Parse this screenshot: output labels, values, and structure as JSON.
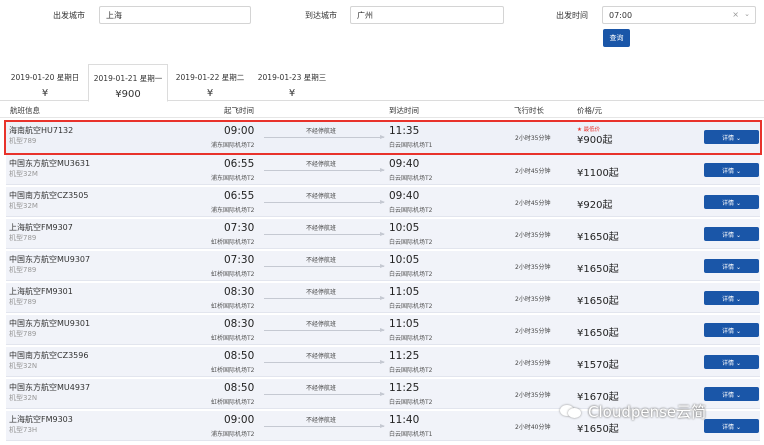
{
  "search": {
    "from_label": "出发城市",
    "from_value": "上海",
    "to_label": "到达城市",
    "to_value": "广州",
    "time_label": "出发时间",
    "time_value": "07:00",
    "clear_glyph": "×",
    "caret_glyph": "⌄",
    "query_label": "查询"
  },
  "date_tabs": [
    {
      "date": "2019-01-20 星期日",
      "price": "¥",
      "active": false
    },
    {
      "date": "2019-01-21 星期一",
      "price": "¥900",
      "active": true
    },
    {
      "date": "2019-01-22 星期二",
      "price": "¥",
      "active": false
    },
    {
      "date": "2019-01-23 星期三",
      "price": "¥",
      "active": false
    }
  ],
  "table_header": {
    "flight_info": "航班信息",
    "depart_time": "起飞时间",
    "arrive_time": "到达时间",
    "duration": "飞行时长",
    "price": "价格/元"
  },
  "rows": [
    {
      "airline": "海南航空HU7132",
      "plane": "机型789",
      "dep": "09:00",
      "dep_airport": "浦东国际机场T2",
      "nonstop": "不经停航班",
      "arr": "11:35",
      "arr_airport": "白云国际机场T1",
      "duration": "2小时35分钟",
      "price": "¥900起",
      "badge": "★ 最低价",
      "detail": "详情 ⌄"
    },
    {
      "airline": "中国东方航空MU3631",
      "plane": "机型32M",
      "dep": "06:55",
      "dep_airport": "浦东国际机场T2",
      "nonstop": "不经停航班",
      "arr": "09:40",
      "arr_airport": "白云国际机场T2",
      "duration": "2小时45分钟",
      "price": "¥1100起",
      "badge": "",
      "detail": "详情 ⌄"
    },
    {
      "airline": "中国南方航空CZ3505",
      "plane": "机型32M",
      "dep": "06:55",
      "dep_airport": "浦东国际机场T2",
      "nonstop": "不经停航班",
      "arr": "09:40",
      "arr_airport": "白云国际机场T2",
      "duration": "2小时45分钟",
      "price": "¥920起",
      "badge": "",
      "detail": "详情 ⌄"
    },
    {
      "airline": "上海航空FM9307",
      "plane": "机型789",
      "dep": "07:30",
      "dep_airport": "虹桥国际机场T2",
      "nonstop": "不经停航班",
      "arr": "10:05",
      "arr_airport": "白云国际机场T2",
      "duration": "2小时35分钟",
      "price": "¥1650起",
      "badge": "",
      "detail": "详情 ⌄"
    },
    {
      "airline": "中国东方航空MU9307",
      "plane": "机型789",
      "dep": "07:30",
      "dep_airport": "虹桥国际机场T2",
      "nonstop": "不经停航班",
      "arr": "10:05",
      "arr_airport": "白云国际机场T2",
      "duration": "2小时35分钟",
      "price": "¥1650起",
      "badge": "",
      "detail": "详情 ⌄"
    },
    {
      "airline": "上海航空FM9301",
      "plane": "机型789",
      "dep": "08:30",
      "dep_airport": "虹桥国际机场T2",
      "nonstop": "不经停航班",
      "arr": "11:05",
      "arr_airport": "白云国际机场T2",
      "duration": "2小时35分钟",
      "price": "¥1650起",
      "badge": "",
      "detail": "详情 ⌄"
    },
    {
      "airline": "中国东方航空MU9301",
      "plane": "机型789",
      "dep": "08:30",
      "dep_airport": "虹桥国际机场T2",
      "nonstop": "不经停航班",
      "arr": "11:05",
      "arr_airport": "白云国际机场T2",
      "duration": "2小时35分钟",
      "price": "¥1650起",
      "badge": "",
      "detail": "详情 ⌄"
    },
    {
      "airline": "中国南方航空CZ3596",
      "plane": "机型32N",
      "dep": "08:50",
      "dep_airport": "虹桥国际机场T2",
      "nonstop": "不经停航班",
      "arr": "11:25",
      "arr_airport": "白云国际机场T2",
      "duration": "2小时35分钟",
      "price": "¥1570起",
      "badge": "",
      "detail": "详情 ⌄"
    },
    {
      "airline": "中国东方航空MU4937",
      "plane": "机型32N",
      "dep": "08:50",
      "dep_airport": "虹桥国际机场T2",
      "nonstop": "不经停航班",
      "arr": "11:25",
      "arr_airport": "白云国际机场T2",
      "duration": "2小时35分钟",
      "price": "¥1670起",
      "badge": "",
      "detail": "详情 ⌄"
    },
    {
      "airline": "上海航空FM9303",
      "plane": "机型73H",
      "dep": "09:00",
      "dep_airport": "浦东国际机场T2",
      "nonstop": "不经停航班",
      "arr": "11:40",
      "arr_airport": "白云国际机场T1",
      "duration": "2小时40分钟",
      "price": "¥1650起",
      "badge": "",
      "detail": "详情 ⌄"
    }
  ],
  "watermark": "Cloudpense云简",
  "colors": {
    "primary": "#1a56a8",
    "highlight_border": "#e8322b",
    "row_bg": "#f1f3f9"
  }
}
